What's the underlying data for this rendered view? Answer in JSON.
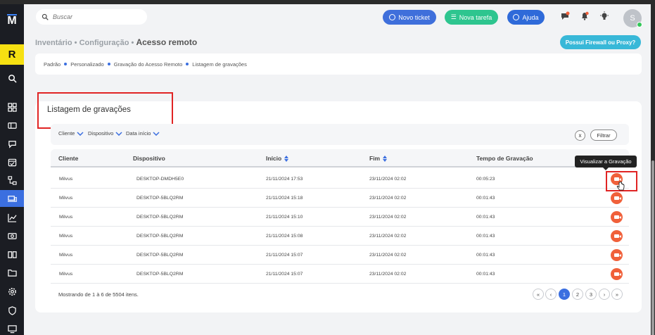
{
  "header": {
    "search_placeholder": "Buscar",
    "btn_ticket": "Novo ticket",
    "btn_tarefa": "Nova tarefa",
    "btn_ajuda": "Ajuda",
    "avatar_initial": "S"
  },
  "sidebar": {
    "logo": "M",
    "badge": "R",
    "items": [
      "search-icon",
      "dashboard-icon",
      "ticket-icon",
      "chat-icon",
      "calendar-icon",
      "hierarchy-icon",
      "devices-icon",
      "chart-icon",
      "money-icon",
      "book-icon",
      "folder-icon",
      "gear-icon",
      "shield-icon",
      "remote-icon"
    ],
    "active_index": 6
  },
  "breadcrumb": {
    "part1": "Inventário",
    "part2": "Configuração",
    "current": "Acesso remoto",
    "sep": "•"
  },
  "firewall_button": "Possui Firewall ou Proxy?",
  "tabs": [
    "Padrão",
    "Personalizado",
    "Gravação do Acesso Remoto",
    "Listagem de gravações"
  ],
  "card": {
    "title": "Listagem de gravações",
    "filters": [
      "Cliente",
      "Dispositivo",
      "Data início"
    ],
    "clear_label": "x",
    "filter_label": "Filtrar"
  },
  "table": {
    "columns": [
      "Cliente",
      "Dispositivo",
      "Início",
      "Fim",
      "Tempo de Gravação"
    ],
    "rows": [
      {
        "cliente": "Milvus",
        "dispositivo": "DESKTOP-DMDH5E0",
        "inicio": "21/11/2024 17:53",
        "fim": "23/11/2024 02:02",
        "tempo": "00:05:23"
      },
      {
        "cliente": "Milvus",
        "dispositivo": "DESKTOP-5BLQ2RM",
        "inicio": "21/11/2024 15:18",
        "fim": "23/11/2024 02:02",
        "tempo": "00:01:43"
      },
      {
        "cliente": "Milvus",
        "dispositivo": "DESKTOP-5BLQ2RM",
        "inicio": "21/11/2024 15:10",
        "fim": "23/11/2024 02:02",
        "tempo": "00:01:43"
      },
      {
        "cliente": "Milvus",
        "dispositivo": "DESKTOP-5BLQ2RM",
        "inicio": "21/11/2024 15:08",
        "fim": "23/11/2024 02:02",
        "tempo": "00:01:43"
      },
      {
        "cliente": "Milvus",
        "dispositivo": "DESKTOP-5BLQ2RM",
        "inicio": "21/11/2024 15:07",
        "fim": "23/11/2024 02:02",
        "tempo": "00:01:43"
      },
      {
        "cliente": "Milvus",
        "dispositivo": "DESKTOP-5BLQ2RM",
        "inicio": "21/11/2024 15:07",
        "fim": "23/11/2024 02:02",
        "tempo": "00:01:43"
      }
    ],
    "tooltip": "Visualizar a Gravação",
    "footer": "Mostrando de 1 à 6 de 5504 itens."
  },
  "pagination": {
    "first": "«",
    "prev": "‹",
    "pages": [
      "1",
      "2",
      "3"
    ],
    "active_page": "1",
    "next": "›",
    "last": "»"
  },
  "colors": {
    "primary": "#3b6fe0",
    "success": "#2ec58f",
    "record": "#f0603a",
    "highlight": "#e02424",
    "sidebar_bg": "#1b1d23",
    "badge_bg": "#f6e012"
  }
}
